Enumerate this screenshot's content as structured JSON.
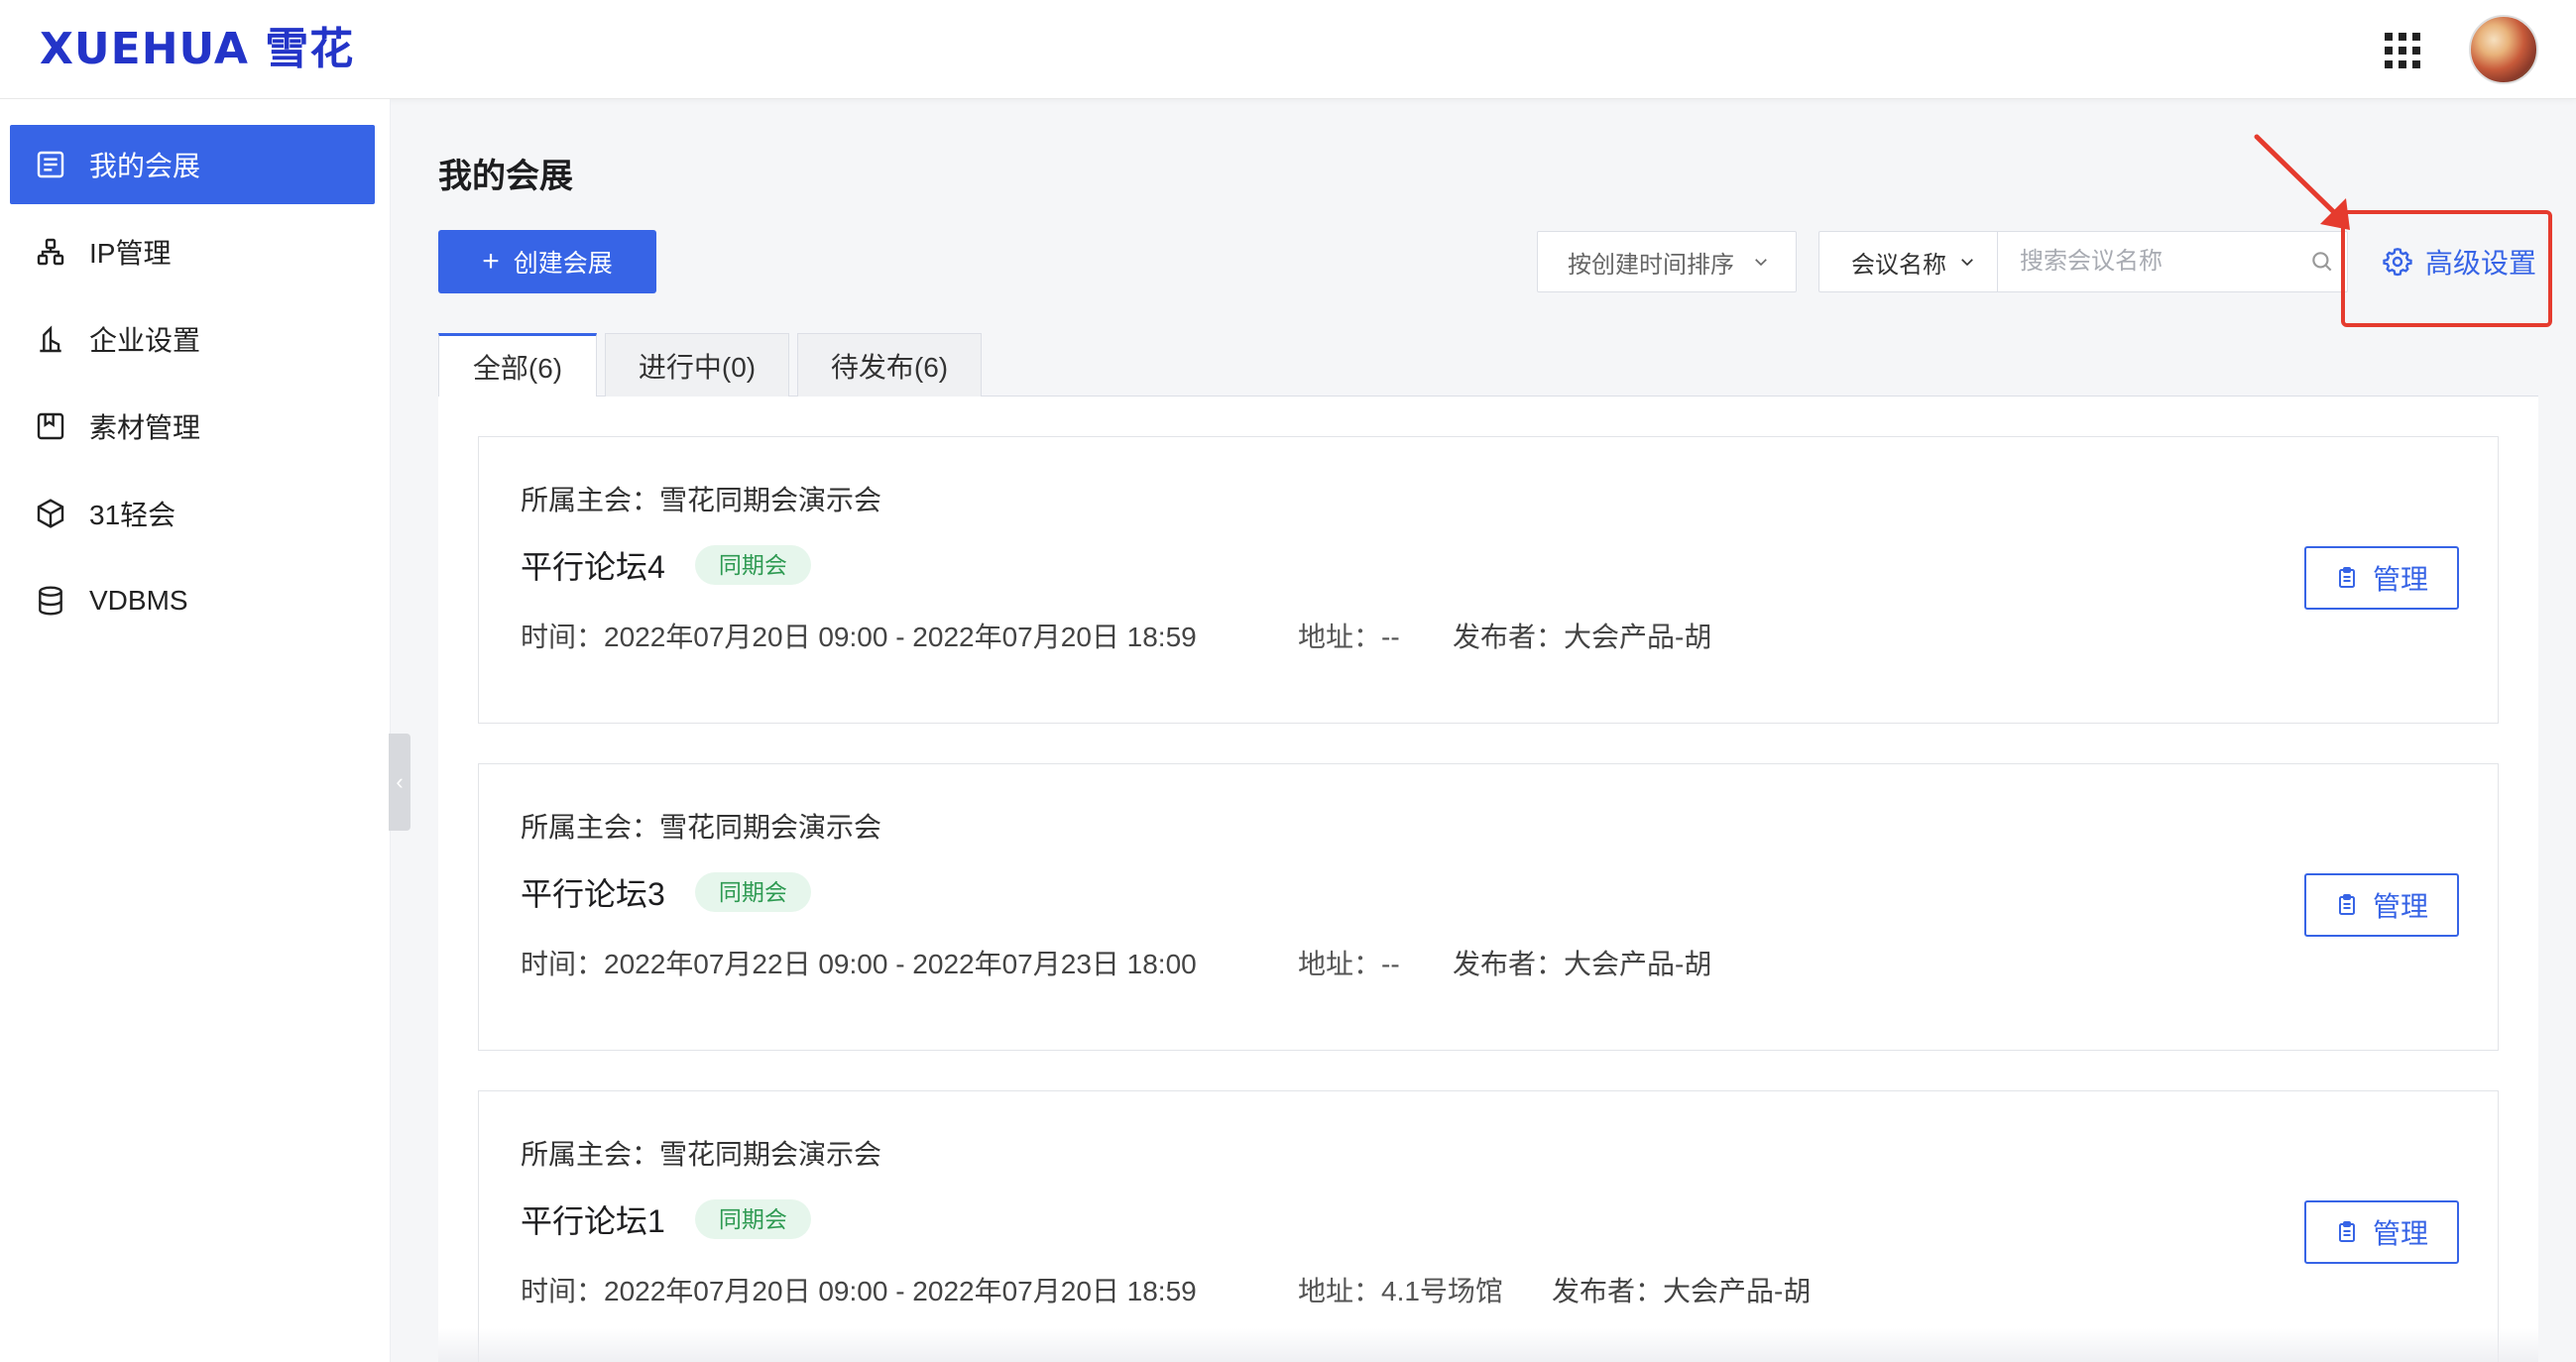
{
  "header": {
    "logo_text": "XUEHUA 雪花",
    "apps_icon": "grid-icon",
    "avatar": "user-avatar"
  },
  "sidebar": {
    "items": [
      {
        "label": "我的会展",
        "icon": "list-icon",
        "active": true
      },
      {
        "label": "IP管理",
        "icon": "hierarchy-icon",
        "active": false
      },
      {
        "label": "企业设置",
        "icon": "building-icon",
        "active": false
      },
      {
        "label": "素材管理",
        "icon": "bookmark-box-icon",
        "active": false
      },
      {
        "label": "31轻会",
        "icon": "cube-icon",
        "active": false
      },
      {
        "label": "VDBMS",
        "icon": "database-icon",
        "active": false
      }
    ],
    "collapse_glyph": "‹"
  },
  "main": {
    "title": "我的会展",
    "create_button": "创建会展",
    "create_icon": "plus-icon",
    "sort_select": "按创建时间排序",
    "search_field_select": "会议名称",
    "search_placeholder": "搜索会议名称",
    "search_value": "",
    "advanced_settings": "高级设置",
    "tabs": [
      {
        "label": "全部(6)",
        "active": true
      },
      {
        "label": "进行中(0)",
        "active": false
      },
      {
        "label": "待发布(6)",
        "active": false
      }
    ],
    "cards": [
      {
        "host": "所属主会：雪花同期会演示会",
        "name": "平行论坛4",
        "tag": "同期会",
        "time": "时间：2022年07月20日 09:00 - 2022年07月20日 18:59",
        "address": "地址：--",
        "publisher": "发布者：大会产品-胡",
        "manage": "管理"
      },
      {
        "host": "所属主会：雪花同期会演示会",
        "name": "平行论坛3",
        "tag": "同期会",
        "time": "时间：2022年07月22日 09:00 - 2022年07月23日 18:00",
        "address": "地址：--",
        "publisher": "发布者：大会产品-胡",
        "manage": "管理"
      },
      {
        "host": "所属主会：雪花同期会演示会",
        "name": "平行论坛1",
        "tag": "同期会",
        "time": "时间：2022年07月20日 09:00 - 2022年07月20日 18:59",
        "address": "地址：4.1号场馆",
        "publisher": "发布者：大会产品-胡",
        "manage": "管理"
      }
    ]
  },
  "colors": {
    "primary": "#3764e6",
    "logo": "#2334c8",
    "annotation": "#e53b2e",
    "tag_bg": "#e6f6ec",
    "tag_text": "#2e9a52"
  }
}
